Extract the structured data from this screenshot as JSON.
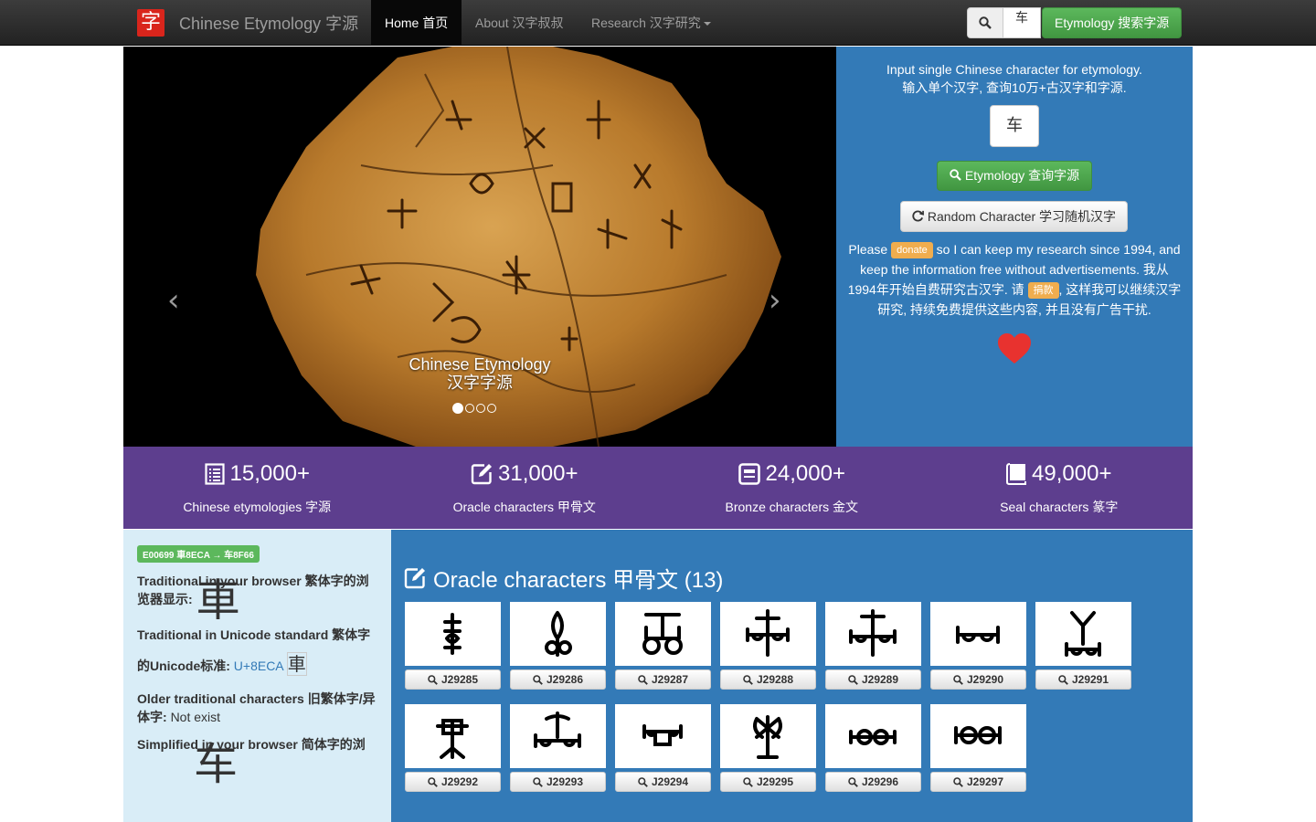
{
  "navbar": {
    "logo_char": "字",
    "brand": "Chinese Etymology 字源",
    "home": "Home 首页",
    "about": "About 汉字叔叔",
    "research": "Research 汉字研究",
    "search_value": "车",
    "search_button": "Etymology 搜索字源"
  },
  "carousel": {
    "caption_en": "Chinese Etymology",
    "caption_zh": "汉字字源",
    "prev": "‹",
    "next": "›"
  },
  "panel": {
    "intro_en": "Input single Chinese character for etymology.",
    "intro_zh": "输入单个汉字, 查询10万+古汉字和字源.",
    "input_value": "车",
    "etymology_button": "Etymology 查询字源",
    "random_button": "Random Character 学习随机汉字",
    "donate_1": "Please",
    "donate_label": "donate",
    "donate_2": "so I can keep my research since 1994, and keep the information free without advertisements.",
    "donate_zh_1": "我从1994年开始自费研究古汉字. 请",
    "donate_zh_label": "捐款",
    "donate_zh_2": ", 这样我可以继续汉字研究, 持续免费提供这些内容, 并且没有广告干扰."
  },
  "stats": [
    {
      "icon": "list-icon",
      "number": "15,000+",
      "label": "Chinese etymologies 字源"
    },
    {
      "icon": "edit-icon",
      "number": "31,000+",
      "label": "Oracle characters 甲骨文"
    },
    {
      "icon": "bronze-icon",
      "number": "24,000+",
      "label": "Bronze characters 金文"
    },
    {
      "icon": "book-icon",
      "number": "49,000+",
      "label": "Seal characters 篆字"
    }
  ],
  "info": {
    "badge": "E00699 車8ECA → 车8F66",
    "trad_browser_label": "Traditional in your browser 繁体字的浏览器显示:",
    "trad_glyph": "車",
    "trad_unicode_label": "Traditional in Unicode standard 繁体字的Unicode标准:",
    "trad_unicode_code": "U+8ECA",
    "trad_unicode_glyph": "車",
    "older_label": "Older traditional characters 旧繁体字/异体字:",
    "older_value": "Not exist",
    "simplified_label": "Simplified in your browser 简体字的浏",
    "simplified_glyph": "车"
  },
  "oracle": {
    "title": "Oracle characters 甲骨文 (13)",
    "items": [
      "J29285",
      "J29286",
      "J29287",
      "J29288",
      "J29289",
      "J29290",
      "J29291",
      "J29292",
      "J29293",
      "J29294",
      "J29295",
      "J29296",
      "J29297"
    ]
  }
}
